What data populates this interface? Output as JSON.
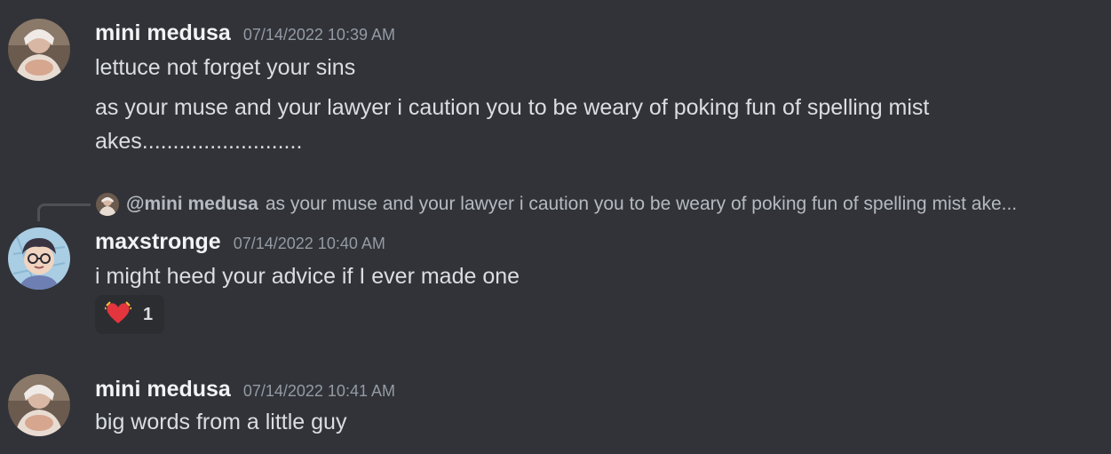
{
  "messages": [
    {
      "author": "mini medusa",
      "timestamp": "07/14/2022 10:39 AM",
      "lines": [
        "lettuce not forget your sins",
        "as your muse and your lawyer i caution you to be weary of poking fun of spelling mist",
        "akes.........................."
      ]
    },
    {
      "reply": {
        "author": "@mini medusa",
        "content": "as your muse and your lawyer i caution you to be weary of poking fun of spelling mist ake..."
      },
      "author": "maxstronge",
      "timestamp": "07/14/2022 10:40 AM",
      "lines": [
        "i might heed your advice if I ever made one"
      ],
      "reaction": {
        "emoji": "heart-eyes-heart-icon",
        "count": "1"
      }
    },
    {
      "author": "mini medusa",
      "timestamp": "07/14/2022 10:41 AM",
      "lines": [
        "big words from a little guy"
      ]
    }
  ],
  "colors": {
    "background": "#313338",
    "username": "#f2f3f5",
    "text": "#dbdee1",
    "timestamp": "#949ba4",
    "reaction_bg": "#2b2d31",
    "heart": "#e2353e"
  }
}
